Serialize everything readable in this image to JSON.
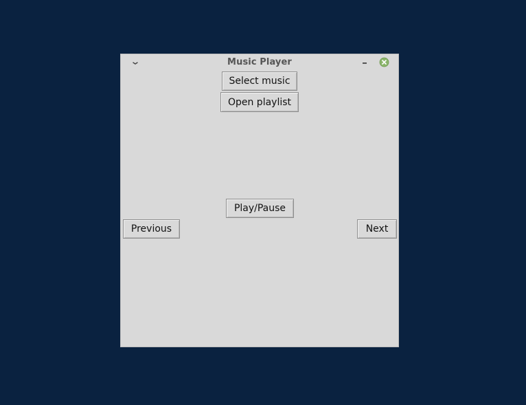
{
  "window": {
    "title": "Music Player",
    "controls": {
      "menu_icon": "chevron-down-icon",
      "minimize_icon": "minimize-icon",
      "close_icon": "close-icon",
      "close_color": "#8bb56b"
    }
  },
  "buttons": {
    "select_music": "Select music",
    "open_playlist": "Open playlist",
    "play_pause": "Play/Pause",
    "previous": "Previous",
    "next": "Next"
  },
  "colors": {
    "desktop_background": "#0a2240",
    "window_background": "#d9d9d9"
  }
}
